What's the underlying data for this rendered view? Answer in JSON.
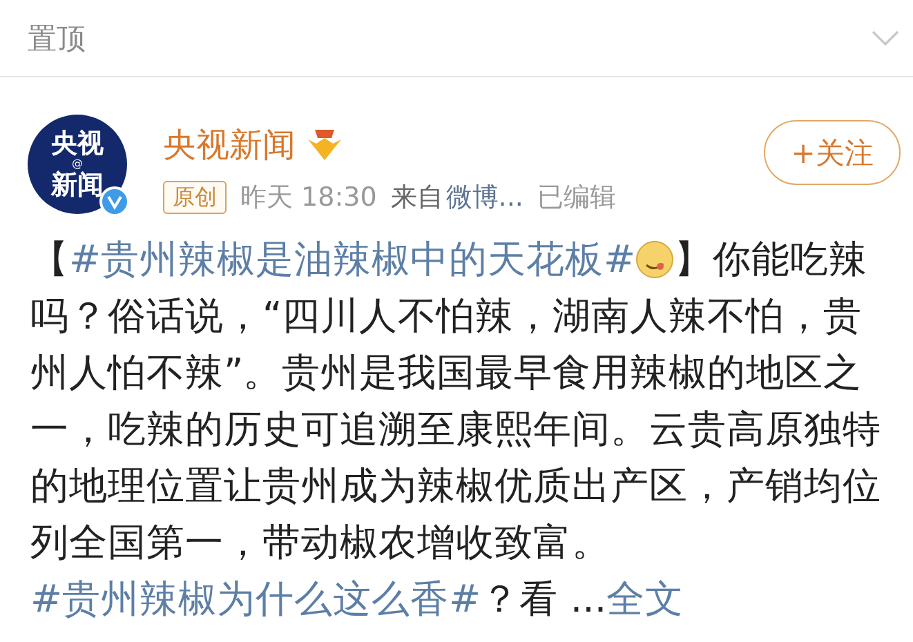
{
  "header": {
    "title": "置顶"
  },
  "post": {
    "avatar": {
      "lines": [
        "央视",
        "新闻"
      ],
      "mark": "@",
      "verified": true
    },
    "author": "央视新闻",
    "follow_button": {
      "label": "+关注"
    },
    "tag": "原创",
    "time": "昨天 18:30",
    "source_prefix": "来自",
    "source": "微博...",
    "edited": "已编辑",
    "body": [
      {
        "kind": "text",
        "text": "【"
      },
      {
        "kind": "hashtag",
        "text": "#贵州辣椒是油辣椒中的天花板#"
      },
      {
        "kind": "emoji"
      },
      {
        "kind": "text",
        "text": "】你能吃辣吗？俗话说，“四川人不怕辣，湖南人辣不怕，贵州人怕不辣”。贵州是我国最早食用辣椒的地区之一，吃辣的历史可追溯至康熙年间。云贵高原独特的地理位置让贵州成为辣椒优质出产区，产销均位列全国第一，带动椒农增收致富。"
      },
      {
        "kind": "hashtag",
        "text": "#贵州辣椒为什么这么香#"
      },
      {
        "kind": "text",
        "text": "？看 ..."
      },
      {
        "kind": "link",
        "text": "全文"
      }
    ]
  }
}
